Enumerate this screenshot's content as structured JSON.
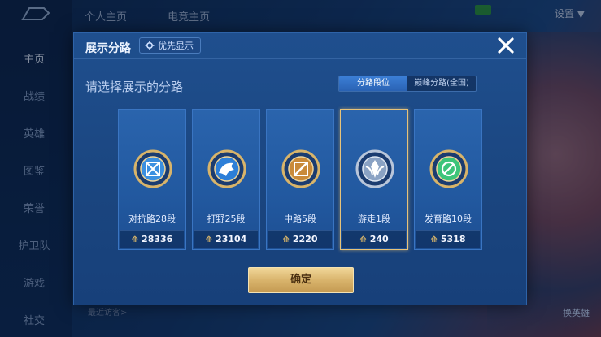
{
  "background": {
    "nav": [
      "主页",
      "战绩",
      "英雄",
      "图鉴",
      "荣誉",
      "护卫队",
      "游戏",
      "社交"
    ],
    "active_nav": "主页",
    "top_tabs": [
      "个人主页",
      "电竞主页"
    ],
    "settings_label": "设置",
    "bottom_text": "最近访客>",
    "hero_button": "换英雄"
  },
  "modal": {
    "title": "展示分路",
    "priority_button": "优先显示",
    "subtitle": "请选择展示的分路",
    "toggle": {
      "active": "分路段位",
      "inactive": "巅峰分路(全国)"
    },
    "cards": [
      {
        "name": "对抗路28段",
        "score": "28336",
        "emblem": "clash-lane-emblem",
        "color": "#3b8fe0",
        "selected": false
      },
      {
        "name": "打野25段",
        "score": "23104",
        "emblem": "jungle-emblem",
        "color": "#2d7fd8",
        "selected": false
      },
      {
        "name": "中路5段",
        "score": "2220",
        "emblem": "mid-lane-emblem",
        "color": "#c98a3a",
        "selected": false
      },
      {
        "name": "游走1段",
        "score": "240",
        "emblem": "roam-emblem",
        "color": "#8aa2c4",
        "selected": true
      },
      {
        "name": "发育路10段",
        "score": "5318",
        "emblem": "farm-lane-emblem",
        "color": "#3cc47a",
        "selected": false
      }
    ],
    "confirm_button": "确定",
    "score_icon": "score-icon"
  }
}
